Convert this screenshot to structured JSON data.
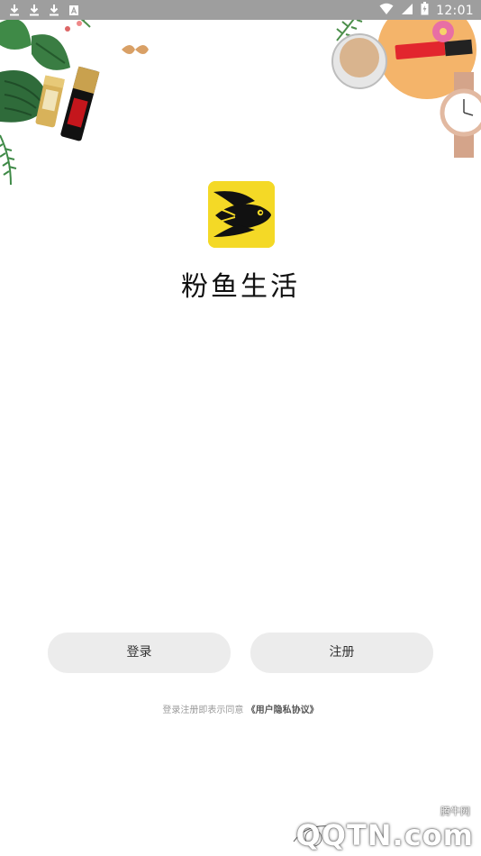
{
  "status_bar": {
    "time": "12:01",
    "left_icons": [
      "download-icon",
      "download-icon",
      "download-icon",
      "font-icon"
    ],
    "right_icons": [
      "wifi-icon",
      "signal-icon",
      "battery-icon"
    ]
  },
  "app": {
    "name": "粉鱼生活",
    "logo_icon": "fish-logo-icon",
    "logo_color": "#f4d926"
  },
  "actions": {
    "login_label": "登录",
    "register_label": "注册"
  },
  "agreement": {
    "prefix": "登录注册即表示同意",
    "link": "《用户隐私协议》"
  },
  "watermark": {
    "small": "腾牛网",
    "large": "QQTN.com"
  },
  "colors": {
    "status_bar": "#9e9e9e",
    "button_bg": "#ececec",
    "background": "#ffffff"
  }
}
